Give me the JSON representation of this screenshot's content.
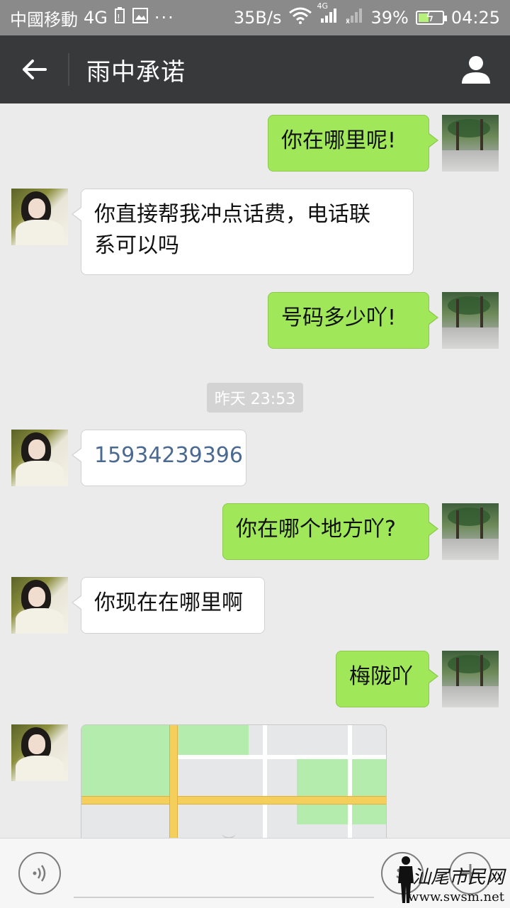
{
  "status_bar": {
    "carrier": "中國移動",
    "network": "4G",
    "speed": "35B/s",
    "signal2_label": "4G",
    "battery": "39%",
    "time": "04:25"
  },
  "header": {
    "back_icon": "arrow-left-icon",
    "title": "雨中承诺",
    "profile_icon": "person-icon"
  },
  "messages": [
    {
      "sender": "self",
      "text": "你在哪里呢!"
    },
    {
      "sender": "other",
      "text_lines": [
        "你直接帮我冲点话费，电话联",
        "系可以吗"
      ]
    },
    {
      "sender": "self",
      "text": "号码多少吖!"
    },
    {
      "sender": "other",
      "text": "15934239396"
    },
    {
      "sender": "self",
      "text": "你在哪个地方吖?"
    },
    {
      "sender": "other",
      "text": "你现在在哪里啊"
    },
    {
      "sender": "self",
      "text": "梅陇吖"
    },
    {
      "sender": "other",
      "type": "location-map"
    }
  ],
  "timestamp": "昨天 23:53",
  "input_bar": {
    "voice_icon": "voice-icon",
    "input_value": "",
    "emoji_icon": "emoji-icon",
    "plus_icon": "plus-icon"
  },
  "watermark": {
    "text": "汕尾市民网",
    "url": "www.swsm.net"
  },
  "colors": {
    "self_bubble": "#a0e75a",
    "other_bubble": "#ffffff",
    "header_bg": "#37393b",
    "background": "#ebebeb"
  }
}
